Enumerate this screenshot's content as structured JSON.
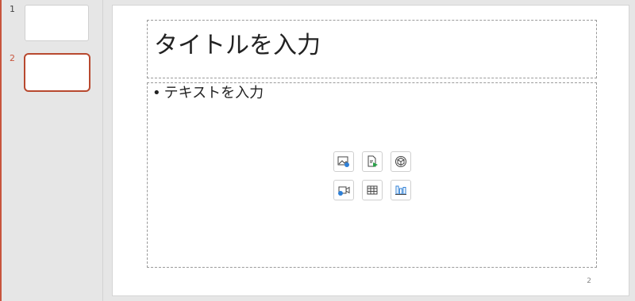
{
  "thumbnails": [
    {
      "number": "1",
      "selected": false
    },
    {
      "number": "2",
      "selected": true
    }
  ],
  "slide": {
    "title_placeholder": "タイトルを入力",
    "body_placeholder": "テキストを入力",
    "bullet": "•",
    "page_number": "2",
    "insert_icons": [
      "insert-picture-icon",
      "insert-smartart-icon",
      "insert-3d-model-icon",
      "insert-video-icon",
      "insert-table-icon",
      "insert-chart-icon"
    ]
  },
  "colors": {
    "selection_accent": "#b8492f",
    "icon_blue": "#2e7fd6",
    "icon_green": "#2aa34a"
  }
}
